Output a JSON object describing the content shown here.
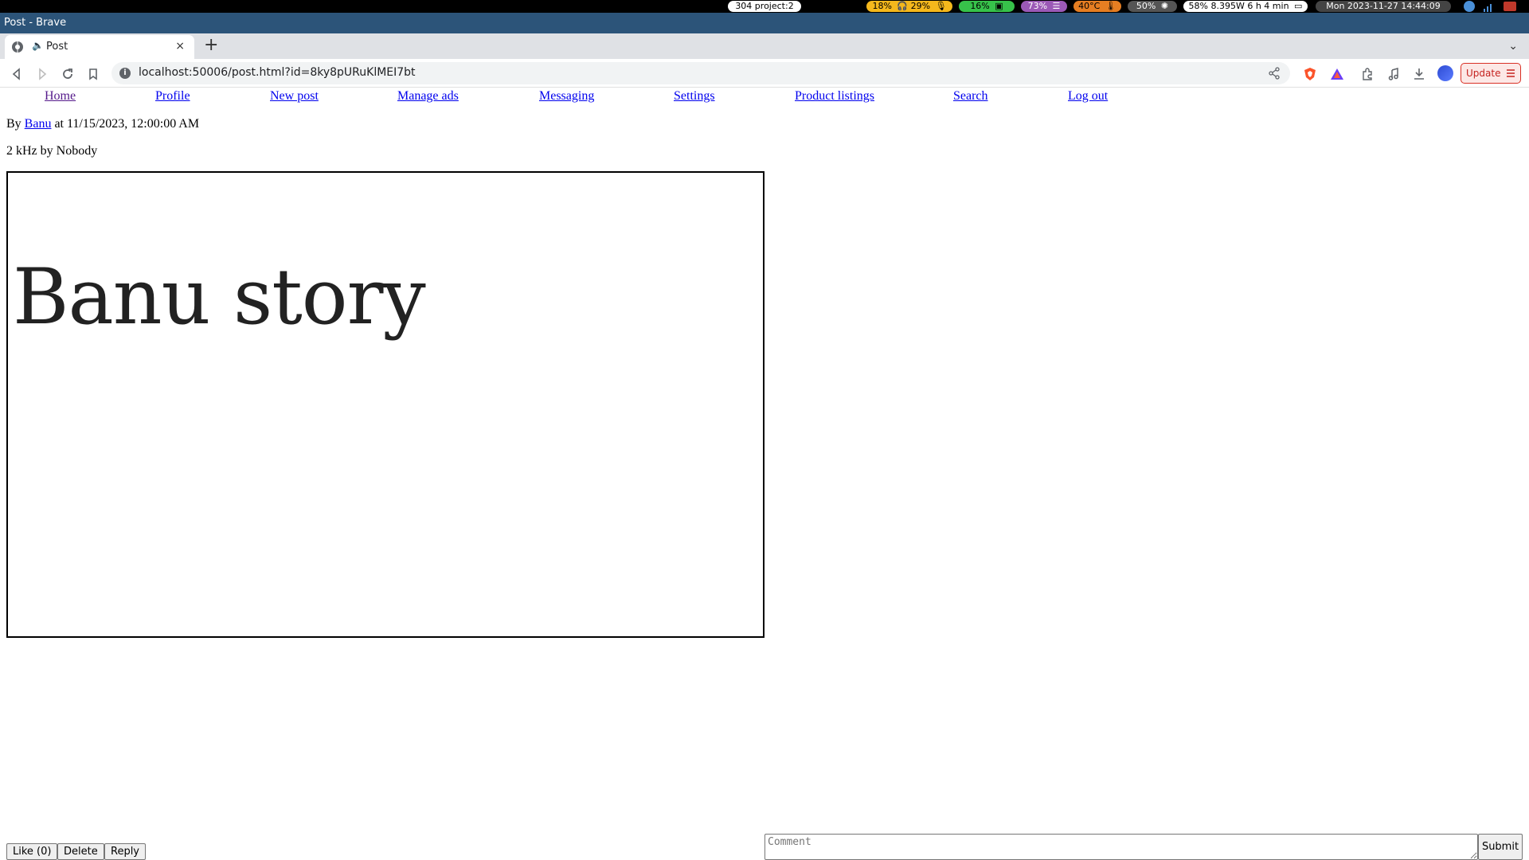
{
  "system_bar": {
    "workspace": "304 project:2",
    "headphones": "18%",
    "mic": "29%",
    "cpu": "16%",
    "memory": "73%",
    "temperature": "40°C",
    "brightness": "50%",
    "battery": "58% 8.395W 6 h 4 min",
    "datetime": "Mon 2023-11-27   14:44:09",
    "colors": {
      "workspace": "#ffffff",
      "audio": "#f5b81c",
      "cpu": "#37c24a",
      "memory": "#9b59b6",
      "temperature": "#e67e22",
      "brightness": "#555555",
      "battery": "#ffffff",
      "datetime": "#444444"
    }
  },
  "window": {
    "title": "Post - Brave"
  },
  "tab": {
    "label": "Post",
    "close": "×",
    "new_tab": "+",
    "tab_list": "⌄"
  },
  "toolbar": {
    "url": "localhost:50006/post.html?id=8ky8pURuKlMEI7bt",
    "update_label": "Update"
  },
  "nav": {
    "home": "Home",
    "profile": "Profile",
    "new_post": "New post",
    "manage_ads": "Manage ads",
    "messaging": "Messaging",
    "settings": "Settings",
    "product_listings": "Product listings",
    "search": "Search",
    "log_out": "Log out"
  },
  "post": {
    "by_prefix": "By",
    "author": "Banu",
    "date_text": "at 11/15/2023, 12:00:00 AM",
    "track": "2 kHz by Nobody",
    "story_text": "Banu story"
  },
  "actions": {
    "like": "Like (0)",
    "delete": "Delete",
    "reply": "Reply",
    "comment_placeholder": "Comment",
    "submit": "Submit"
  }
}
